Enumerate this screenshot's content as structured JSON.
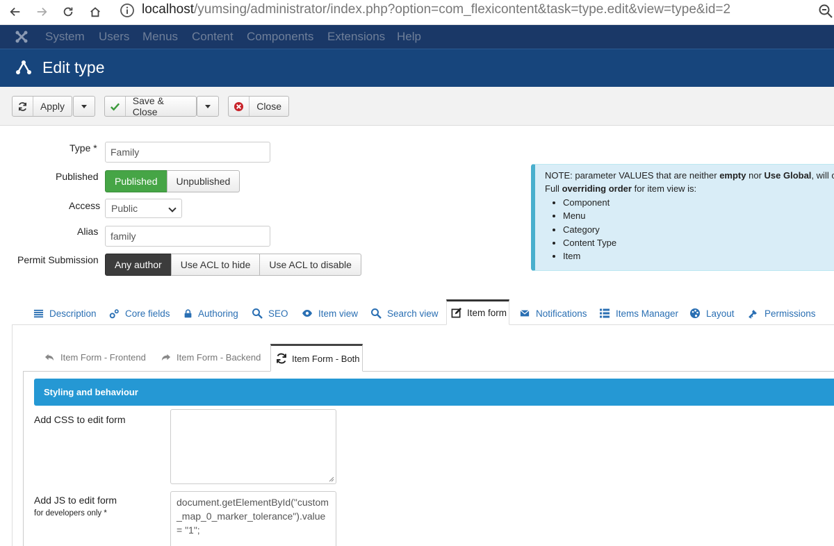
{
  "browser": {
    "url_host": "localhost",
    "url_path": "/yumsing/administrator/index.php?option=com_flexicontent&task=type.edit&view=type&id=2"
  },
  "topmenu": {
    "items": [
      "System",
      "Users",
      "Menus",
      "Content",
      "Components",
      "Extensions",
      "Help"
    ]
  },
  "header": {
    "title": "Edit type"
  },
  "toolbar": {
    "apply": "Apply",
    "save_close": "Save & Close",
    "close": "Close"
  },
  "form": {
    "type_label": "Type *",
    "type_value": "Family",
    "published_label": "Published",
    "published_options": [
      "Published",
      "Unpublished"
    ],
    "access_label": "Access",
    "access_value": "Public",
    "alias_label": "Alias",
    "alias_value": "family",
    "permit_label": "Permit Submission",
    "permit_options": [
      "Any author",
      "Use ACL to hide",
      "Use ACL to disable"
    ]
  },
  "note": {
    "line1_a": "NOTE: parameter VALUES that are neither ",
    "line1_b": "empty",
    "line1_c": " nor ",
    "line1_d": "Use Global",
    "line1_e": ", will o",
    "line2_a": "Full ",
    "line2_b": "overriding order",
    "line2_c": " for item view is:",
    "items": [
      "Component",
      "Menu",
      "Category",
      "Content Type",
      "Item"
    ]
  },
  "tabs": [
    "Description",
    "Core fields",
    "Authoring",
    "SEO",
    "Item view",
    "Search view",
    "Item form",
    "Notifications",
    "Items Manager",
    "Layout",
    "Permissions"
  ],
  "subtabs": [
    "Item Form - Frontend",
    "Item Form - Backend",
    "Item Form - Both"
  ],
  "section": {
    "title": "Styling and behaviour",
    "css_label": "Add CSS to edit form",
    "css_value": "",
    "js_label": "Add JS to edit form",
    "js_sublabel": "for developers only *",
    "js_value": "document.getElementById(\"custom_map_0_marker_tolerance\").value = \"1\";"
  },
  "colors": {
    "topmenu_bg": "#1a3867",
    "titlebar_bg": "#17457c",
    "published_green": "#46a546",
    "section_blue": "#2598d4",
    "link_blue": "#2a6fb3"
  }
}
